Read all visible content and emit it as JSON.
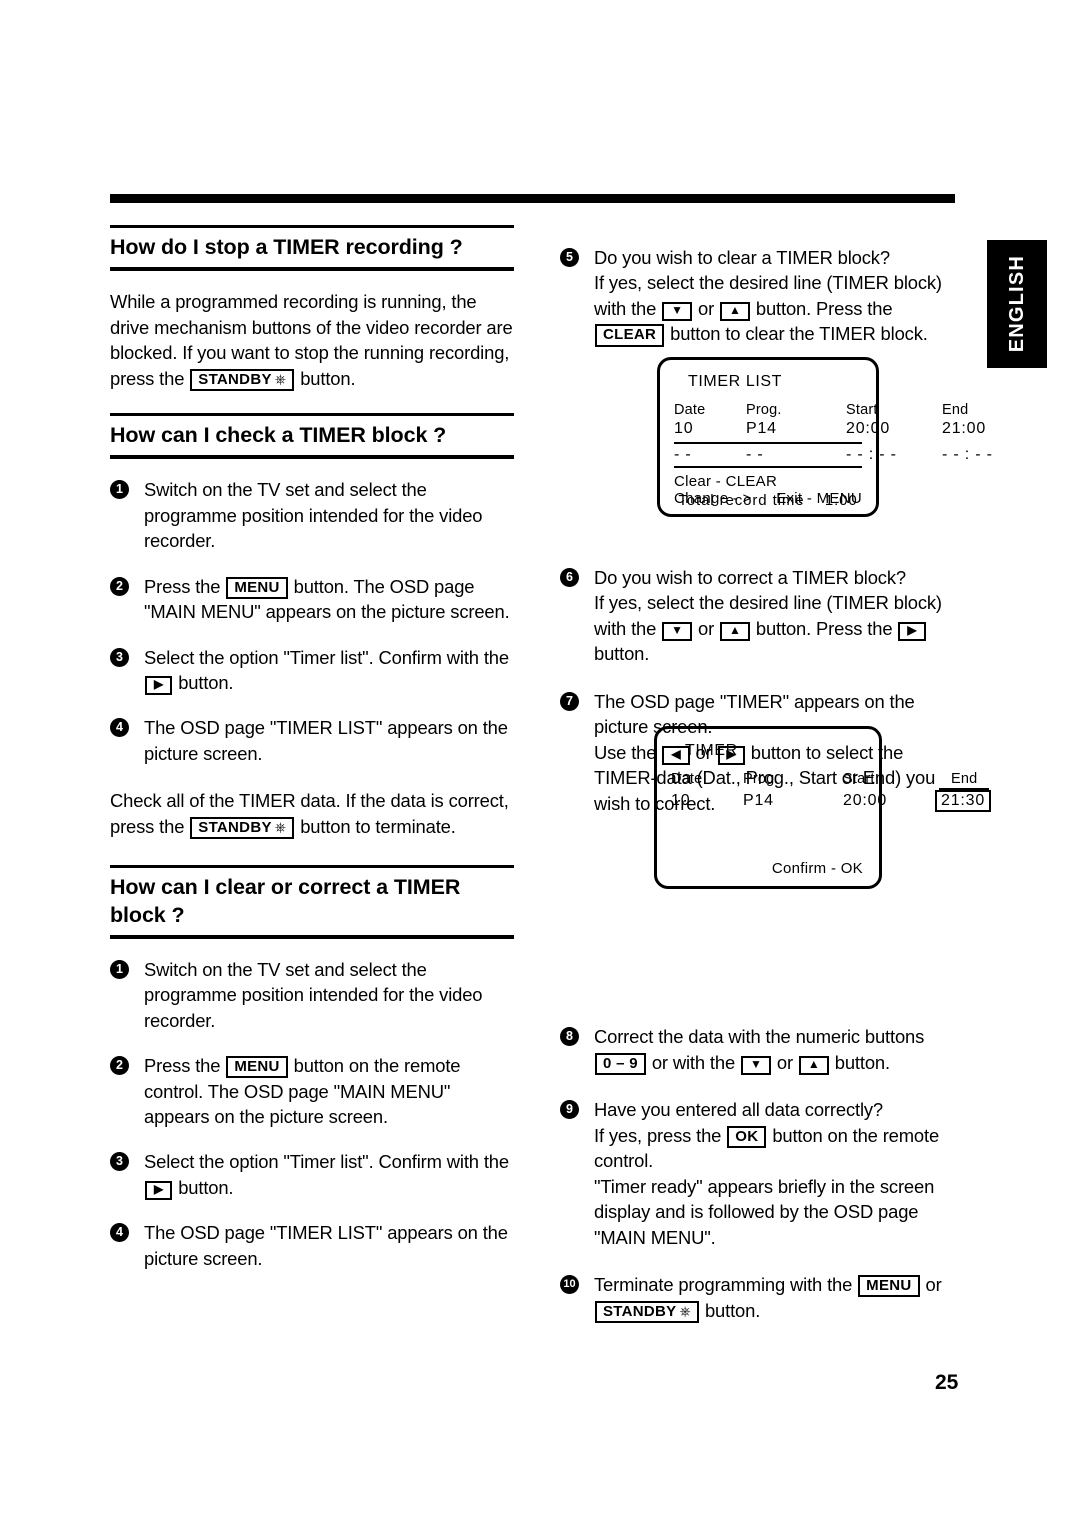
{
  "language_tab": {
    "label": "ENGLISH"
  },
  "page_number": "25",
  "left_column": {
    "section1": {
      "heading": "How do I stop a TIMER recording ?",
      "paragraph_before_key": "While a programmed recording is running, the drive mechanism buttons of the video recorder are blocked. If you want to stop the running recording, press the",
      "key_standby": "STANDBY",
      "paragraph_after_key": "button."
    },
    "section2": {
      "heading": "How can I check a TIMER block ?",
      "steps": [
        {
          "num": "1",
          "text": "Switch on the TV set and select the programme position intended for the video recorder."
        },
        {
          "num": "2",
          "pre": "Press the",
          "key": "MENU",
          "post": "button. The OSD page \"MAIN MENU\" appears on the picture screen."
        },
        {
          "num": "3",
          "pre": "Select the option \"Timer list\". Confirm with the",
          "key": "▶",
          "post": "button."
        },
        {
          "num": "4",
          "text": "The OSD page \"TIMER LIST\" appears on the picture screen."
        }
      ],
      "closing_pre": "Check all of the TIMER data. If the data is correct, press the",
      "closing_key": "STANDBY",
      "closing_post": "button to terminate."
    },
    "section3": {
      "heading": "How can I clear or correct a TIMER block ?",
      "steps": [
        {
          "num": "1",
          "text": "Switch on the TV set and select the programme position intended for the video recorder."
        },
        {
          "num": "2",
          "pre": "Press the",
          "key": "MENU",
          "post": "button on the remote control. The OSD page \"MAIN MENU\" appears on the picture screen."
        },
        {
          "num": "3",
          "pre": "Select the option \"Timer list\". Confirm with the",
          "key": "▶",
          "post": "button."
        },
        {
          "num": "4",
          "text": "The OSD page \"TIMER LIST\" appears on the picture screen."
        }
      ]
    }
  },
  "right_column": {
    "step5": {
      "num": "5",
      "line1": "Do you wish to clear a TIMER block?",
      "line2_pre": "If yes, select the desired line (TIMER block) with the",
      "key_down": "▼",
      "or": "or",
      "key_up": "▲",
      "mid": "button. Press the",
      "key_clear": "CLEAR",
      "post": "button to clear the TIMER block."
    },
    "step6": {
      "num": "6",
      "line1": "Do you wish to correct a TIMER block?",
      "line2_pre": "If yes, select the desired line (TIMER block) with the",
      "key_down": "▼",
      "or": "or",
      "key_up": "▲",
      "mid": "button. Press the",
      "key_right": "▶",
      "post": "button."
    },
    "step7": {
      "num": "7",
      "line1": "The OSD page  \"TIMER\" appears on the picture screen.",
      "line2_pre": "Use the",
      "key_left": "◀",
      "or": "or",
      "key_right": "▶",
      "post": "button to select the TIMER-data (Dat., Prog., Start or End) you wish to correct."
    },
    "step8": {
      "num": "8",
      "pre": "Correct the data with the numeric buttons",
      "key_numeric": "0 – 9",
      "mid": "or with the",
      "key_down": "▼",
      "or": "or",
      "key_up": "▲",
      "post": "button."
    },
    "step9": {
      "num": "9",
      "line1": "Have you entered all data correctly?",
      "line2_pre": "If yes, press the",
      "key_ok": "OK",
      "line2_post": "button on the remote control.",
      "line3": "\"Timer ready\" appears briefly in the screen display and is followed by the OSD page \"MAIN MENU\"."
    },
    "step10": {
      "num": "10",
      "pre": "Terminate programming with the",
      "key_menu": "MENU",
      "or": "or",
      "key_standby": "STANDBY",
      "post": "button."
    }
  },
  "osd_timer_list": {
    "title": "TIMER LIST",
    "headers": [
      "Date",
      "Prog.",
      "Start",
      "End"
    ],
    "rows": [
      [
        "10",
        "P14",
        "20:00",
        "21:00"
      ],
      [
        "- -",
        "- -",
        "- - : - -",
        "- - : - -"
      ]
    ],
    "total_label": "Total  record time",
    "total_value": "1:00",
    "footer_clear": "Clear - CLEAR",
    "footer_change": "Change - >",
    "footer_exit": "Exit - MENU"
  },
  "osd_timer": {
    "title": "TIMER",
    "headers": [
      "Date",
      "Prog.",
      "Start",
      "End"
    ],
    "row": [
      "10",
      "P14",
      "20:00",
      "21:30"
    ],
    "selected_field": "End",
    "footer_confirm": "Confirm - OK"
  }
}
